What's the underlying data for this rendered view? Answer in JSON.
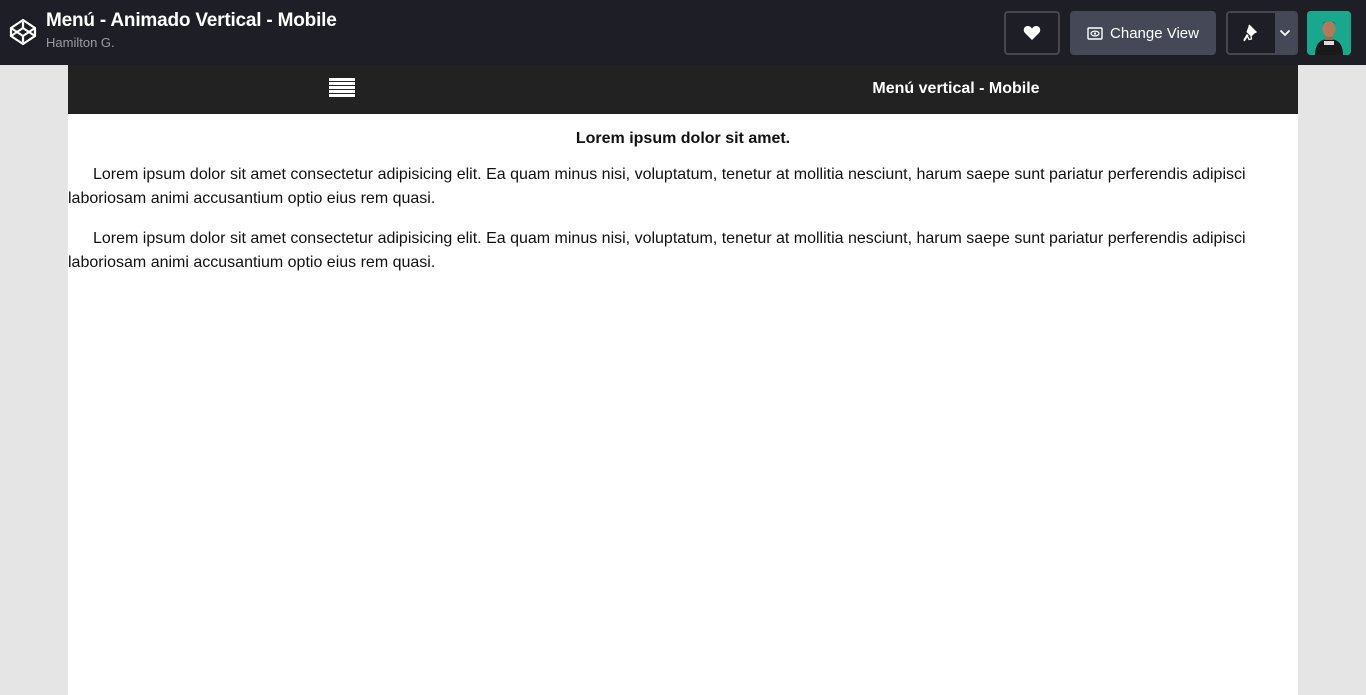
{
  "header": {
    "pen_title": "Menú - Animado Vertical - Mobile",
    "author": "Hamilton G.",
    "change_view_label": "Change View",
    "icons": {
      "logo": "codepen-logo-icon",
      "heart": "heart-icon",
      "change_view": "eye-icon",
      "pin": "pin-icon",
      "dropdown": "chevron-down-icon"
    },
    "colors": {
      "background": "#1e1f26",
      "button": "#444857",
      "avatar_bg": "#19a88e"
    }
  },
  "preview": {
    "nav": {
      "menu_icon": "hamburger-menu-icon",
      "title": "Menú vertical - Mobile",
      "background": "#222222"
    },
    "heading": "Lorem ipsum dolor sit amet.",
    "paragraphs": [
      "Lorem ipsum dolor sit amet consectetur adipisicing elit. Ea quam minus nisi, voluptatum, tenetur at mollitia nesciunt, harum saepe sunt pariatur perferendis adipisci laboriosam animi accusantium optio eius rem quasi.",
      "Lorem ipsum dolor sit amet consectetur adipisicing elit. Ea quam minus nisi, voluptatum, tenetur at mollitia nesciunt, harum saepe sunt pariatur perferendis adipisci laboriosam animi accusantium optio eius rem quasi."
    ]
  }
}
